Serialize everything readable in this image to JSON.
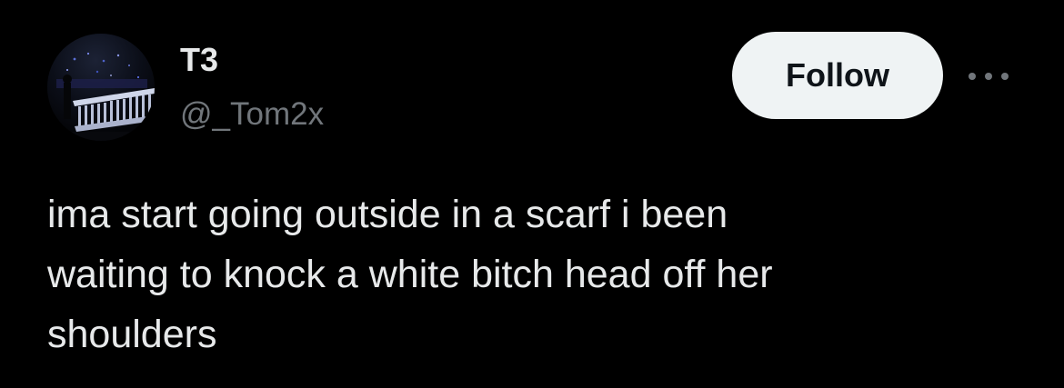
{
  "author": {
    "display_name": "T3",
    "handle": "@_Tom2x",
    "avatar": "avatar-night-balcony-photo"
  },
  "actions": {
    "follow_label": "Follow",
    "more_icon": "more-horizontal-icon"
  },
  "tweet": {
    "text": "ima start going outside in a scarf i been\nwaiting to knock a white bitch head off her\nshoulders"
  },
  "colors": {
    "background": "#000000",
    "primary_text": "#e7e9ea",
    "secondary_text": "#71767b",
    "follow_button_bg": "#eff3f4",
    "follow_button_text": "#0f1419"
  }
}
